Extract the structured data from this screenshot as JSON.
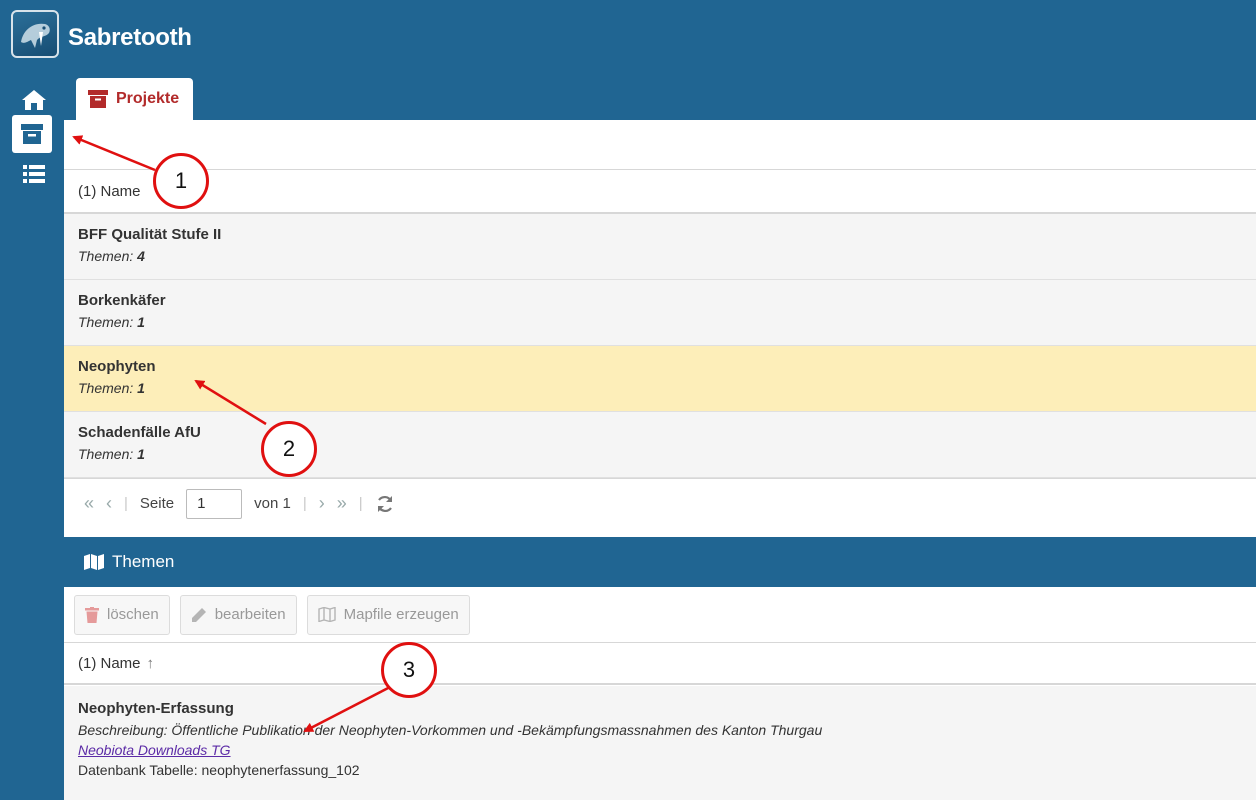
{
  "app": {
    "title": "Sabretooth"
  },
  "nav": {
    "items": [
      {
        "name": "home",
        "icon": "home-icon"
      },
      {
        "name": "projects",
        "icon": "archive-box-icon",
        "active": true
      },
      {
        "name": "list",
        "icon": "list-icon"
      }
    ]
  },
  "tab": {
    "label": "Projekte",
    "icon": "archive-box-icon"
  },
  "projects": {
    "column_header": "(1) Name",
    "rows": [
      {
        "title": "BFF Qualität Stufe II",
        "sub_label": "Themen:",
        "sub_value": "4",
        "selected": false
      },
      {
        "title": "Borkenkäfer",
        "sub_label": "Themen:",
        "sub_value": "1",
        "selected": false
      },
      {
        "title": "Neophyten",
        "sub_label": "Themen:",
        "sub_value": "1",
        "selected": true
      },
      {
        "title": "Schadenfälle AfU",
        "sub_label": "Themen:",
        "sub_value": "1",
        "selected": false
      }
    ]
  },
  "pager": {
    "first": "«",
    "prev": "‹",
    "page_label": "Seite",
    "page_value": "1",
    "of_label": "von 1",
    "next": "›",
    "last": "»"
  },
  "themen": {
    "title": "Themen",
    "buttons": {
      "delete": "löschen",
      "edit": "bearbeiten",
      "mapfile": "Mapfile erzeugen"
    },
    "column_header": "(1) Name",
    "sort_indicator": "↑",
    "row": {
      "title": "Neophyten-Erfassung",
      "desc": "Beschreibung: Öffentliche Publikation der Neophyten-Vorkommen und -Bekämpfungsmassnahmen des Kanton Thurgau",
      "link": "Neobiota Downloads TG",
      "db": "Datenbank Tabelle: neophytenerfassung_102"
    }
  },
  "annotations": {
    "one": "1",
    "two": "2",
    "three": "3"
  },
  "colors": {
    "brand": "#206592",
    "selected_row": "#fdeeb9",
    "tab_text": "#b22a2a",
    "annotation": "#e01010"
  }
}
